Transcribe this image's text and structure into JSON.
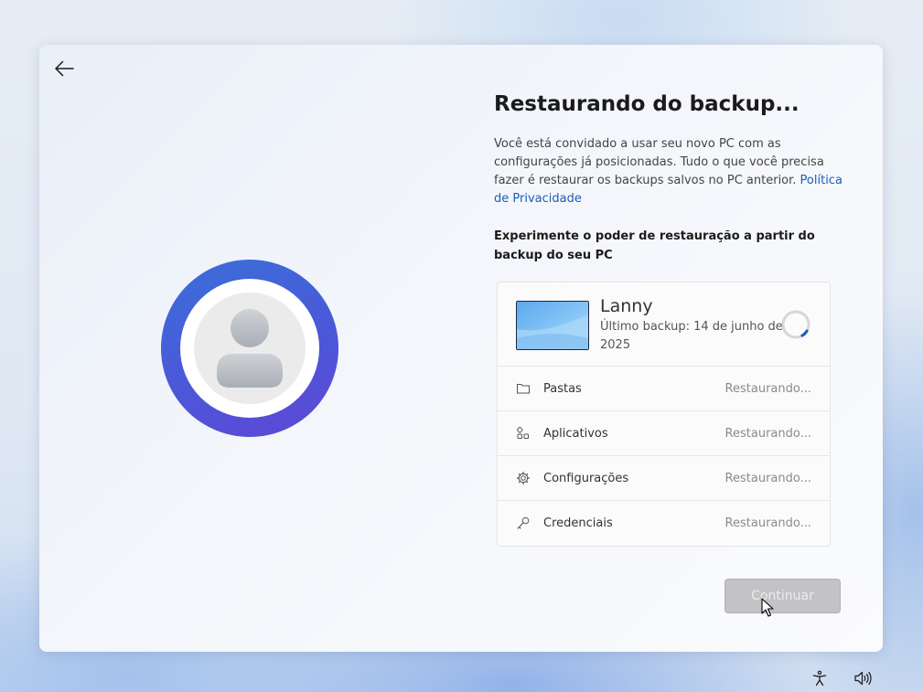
{
  "header": {
    "back_icon": "arrow-left-icon",
    "title": "Restaurando do backup..."
  },
  "description": {
    "text": "Você está convidado a usar seu novo PC com as configurações já posicionadas. Tudo o que você precisa fazer é restaurar os backups salvos no PC anterior. ",
    "link": "Política de Privacidade"
  },
  "subheading": "Experimente o poder de restauração a partir do backup do seu PC",
  "avatar": {
    "icon": "user-silhouette-icon"
  },
  "backup_card": {
    "device_name": "Lanny",
    "last_backup": "Último backup: 14 de junho de 2025",
    "spinner_icon": "loading-spinner-icon",
    "items": [
      {
        "label": "Pastas",
        "status": "Restaurando...",
        "icon": "folder-icon"
      },
      {
        "label": "Aplicativos",
        "status": "Restaurando...",
        "icon": "apps-icon"
      },
      {
        "label": "Configurações",
        "status": "Restaurando...",
        "icon": "gear-icon"
      },
      {
        "label": "Credenciais",
        "status": "Restaurando...",
        "icon": "key-icon"
      }
    ]
  },
  "footer": {
    "continue_label": "Continuar",
    "continue_enabled": false
  },
  "taskbar": {
    "accessibility_icon": "accessibility-icon",
    "volume_icon": "volume-icon"
  },
  "colors": {
    "accent_link": "#1a5fb4",
    "avatar_ring_start": "#3a6fd8",
    "avatar_ring_end": "#5f46d6",
    "button_disabled": "#c3c3c6"
  }
}
